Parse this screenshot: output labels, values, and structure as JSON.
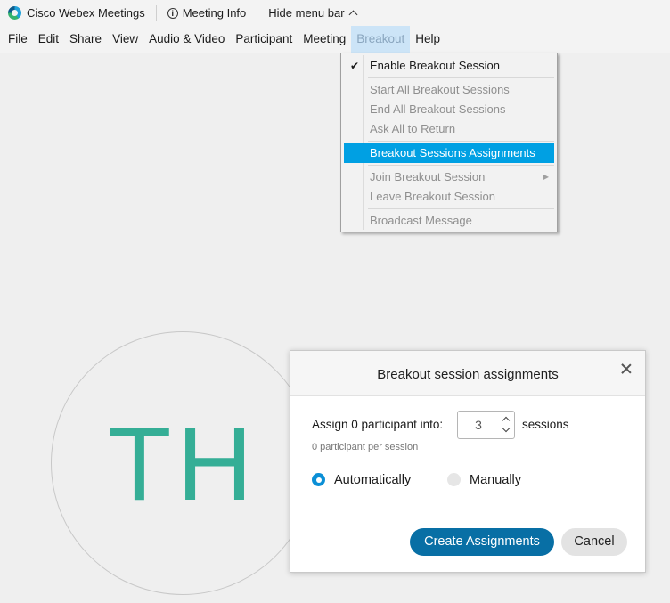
{
  "titlebar": {
    "app_name": "Cisco Webex Meetings",
    "meeting_info": "Meeting Info",
    "hide_menu_bar": "Hide menu bar"
  },
  "menubar": {
    "items": [
      "File",
      "Edit",
      "Share",
      "View",
      "Audio & Video",
      "Participant",
      "Meeting",
      "Breakout",
      "Help"
    ],
    "active": "Breakout"
  },
  "breakout_menu": {
    "enable": "Enable Breakout Session",
    "enable_checked": true,
    "start_all": "Start All Breakout Sessions",
    "end_all": "End All Breakout Sessions",
    "ask_all_return": "Ask All to Return",
    "assignments": "Breakout Sessions Assignments",
    "join": "Join Breakout Session",
    "leave": "Leave Breakout Session",
    "broadcast": "Broadcast Message"
  },
  "avatar": {
    "initials": "TH",
    "color": "#35ae96"
  },
  "dialog": {
    "title": "Breakout session assignments",
    "assign_label": "Assign 0 participant into:",
    "session_count": "3",
    "sessions_label": "sessions",
    "per_session": "0 participant per session",
    "option_auto": "Automatically",
    "option_manual": "Manually",
    "selected_option": "Automatically",
    "create_button": "Create Assignments",
    "cancel_button": "Cancel"
  },
  "colors": {
    "menu_highlight": "#00a0e3",
    "primary_button": "#086fa5",
    "radio_selected": "#0b8fd6"
  }
}
